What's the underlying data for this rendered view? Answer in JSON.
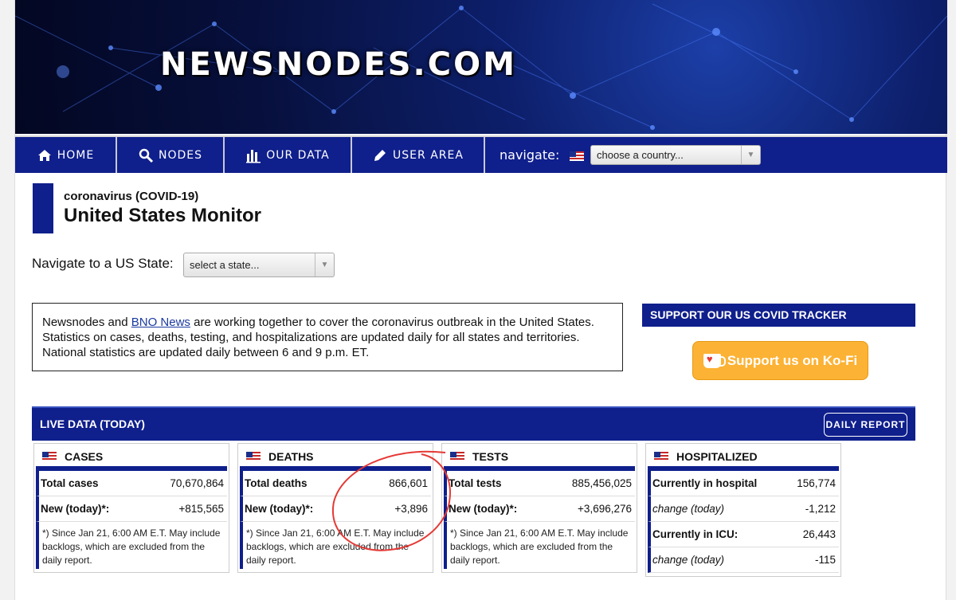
{
  "site": {
    "logo": "NEWSNODES.COM"
  },
  "nav": {
    "items": [
      {
        "label": "HOME",
        "icon": "home-icon"
      },
      {
        "label": "NODES",
        "icon": "search-icon"
      },
      {
        "label": "OUR DATA",
        "icon": "bar-chart-icon"
      },
      {
        "label": "USER AREA",
        "icon": "pencil-icon"
      }
    ],
    "navigate_label": "navigate:",
    "country_select": "choose a country..."
  },
  "header": {
    "subtitle": "coronavirus (COVID-19)",
    "title": "United States Monitor"
  },
  "state_nav": {
    "label": "Navigate to a US State:",
    "select": "select a state..."
  },
  "intro": {
    "prefix": "Newsnodes and ",
    "link": "BNO News",
    "suffix": " are working together to cover the coronavirus outbreak in the United States. Statistics on cases, deaths, testing, and hospitalizations are updated daily for all states and territories. National statistics are updated daily between 6 and 9 p.m. ET."
  },
  "support": {
    "heading": "SUPPORT OUR US COVID TRACKER",
    "button": "Support us on Ko-Fi"
  },
  "live": {
    "label": "LIVE DATA (TODAY)",
    "daily_report": "DAILY REPORT"
  },
  "cards": {
    "cases": {
      "title": "CASES",
      "total_label": "Total cases",
      "total_value": "70,670,864",
      "new_label": "New (today)*:",
      "new_value": "+815,565",
      "note": "*) Since Jan 21, 6:00 AM E.T. May include backlogs, which are excluded from the daily report."
    },
    "deaths": {
      "title": "DEATHS",
      "total_label": "Total deaths",
      "total_value": "866,601",
      "new_label": "New (today)*:",
      "new_value": "+3,896",
      "note": "*) Since Jan 21, 6:00 AM E.T. May include backlogs, which are excluded from the daily report."
    },
    "tests": {
      "title": "TESTS",
      "total_label": "Total tests",
      "total_value": "885,456,025",
      "new_label": "New (today)*:",
      "new_value": "+3,696,276",
      "note": "*) Since Jan 21, 6:00 AM E.T. May include backlogs, which are excluded from the daily report."
    },
    "hospitalized": {
      "title": "HOSPITALIZED",
      "hospital_label": "Currently in hospital",
      "hospital_value": "156,774",
      "hospital_change_label": "change (today)",
      "hospital_change_value": "-1,212",
      "icu_label": "Currently in ICU:",
      "icu_value": "26,443",
      "icu_change_label": "change (today)",
      "icu_change_value": "-115"
    }
  },
  "colors": {
    "navy": "#0f1f8c",
    "kofi": "#fcb234",
    "annotation": "#e53935"
  }
}
